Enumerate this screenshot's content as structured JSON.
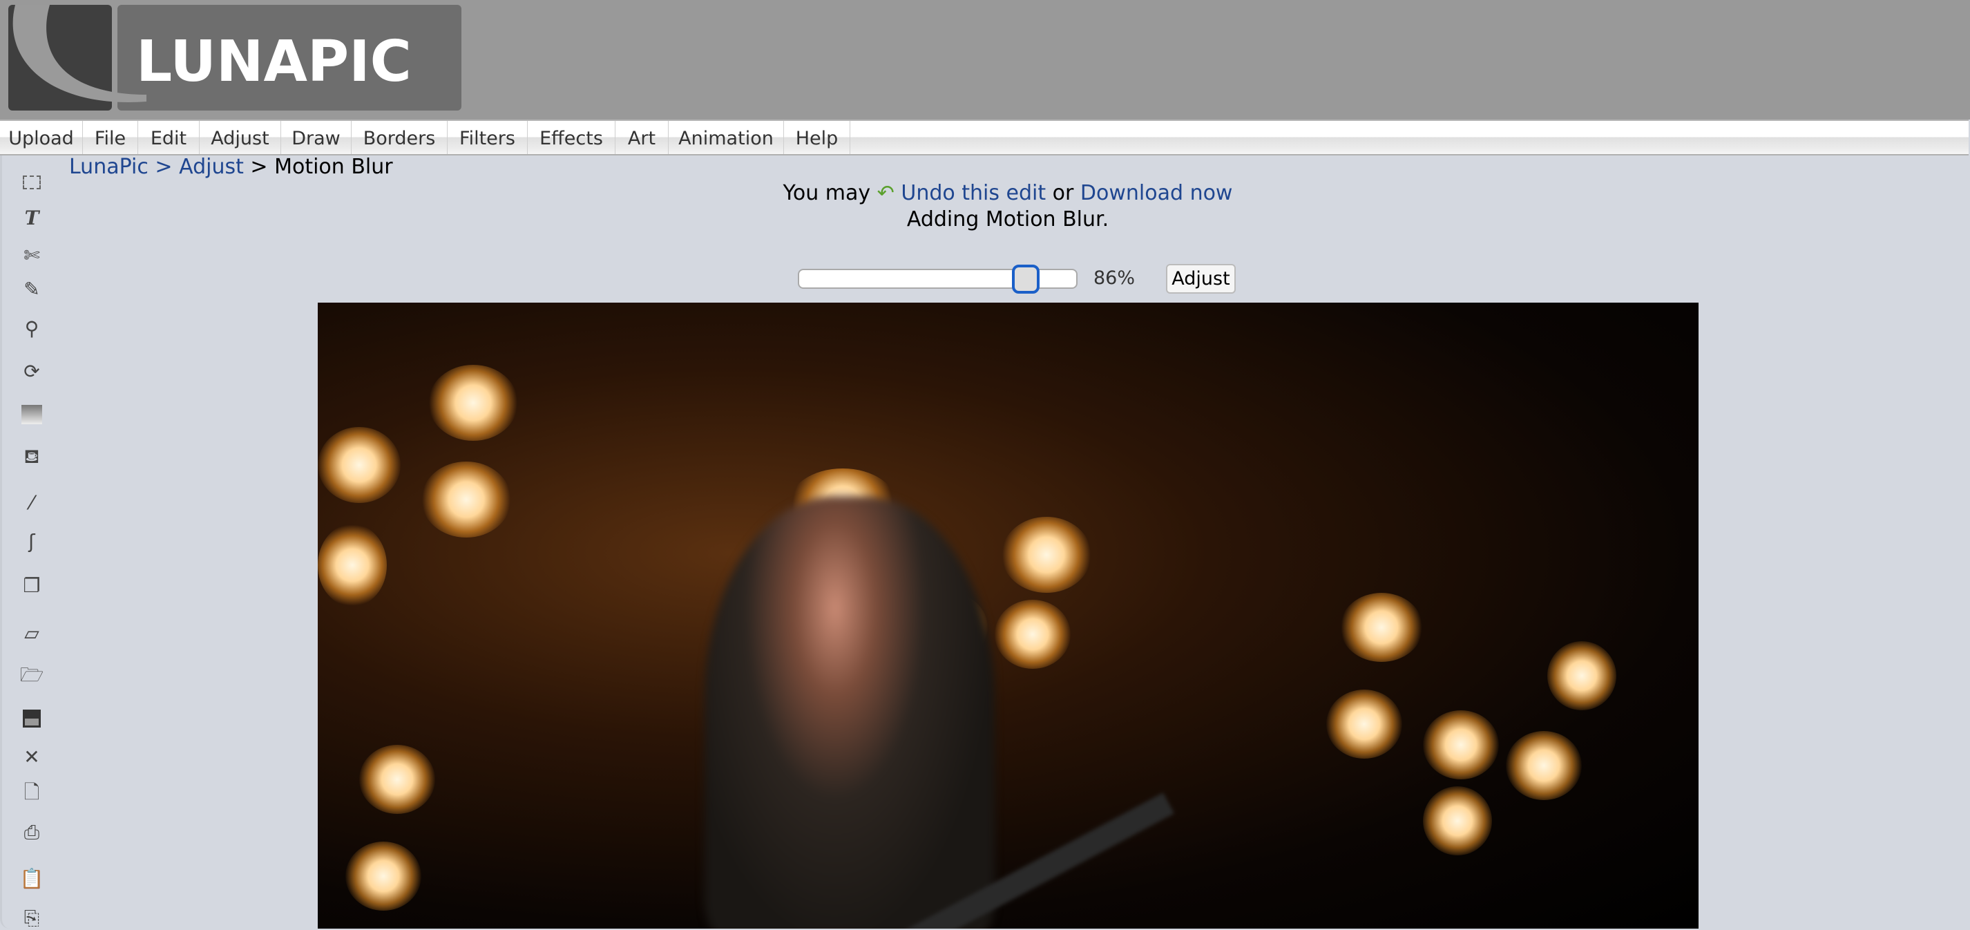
{
  "header": {
    "logo_text": "LUNAPIC"
  },
  "menu": [
    "Upload",
    "File",
    "Edit",
    "Adjust",
    "Draw",
    "Borders",
    "Filters",
    "Effects",
    "Art",
    "Animation",
    "Help"
  ],
  "toolbar": [
    "select-icon",
    "text-icon",
    "scissors-icon",
    "pencil-icon",
    "magnifier-icon",
    "rotate-icon",
    "gradient-icon",
    "paint-bucket-icon",
    "eyedropper-icon",
    "brush-icon",
    "layers-icon",
    "eraser-icon",
    "open-folder-icon",
    "save-icon",
    "close-icon",
    "new-document-icon",
    "print-icon",
    "paste-icon",
    "copy-icon"
  ],
  "breadcrumb": {
    "root": "LunaPic",
    "sep1": " > ",
    "section": "Adjust",
    "sep2": " > ",
    "current": "Motion Blur"
  },
  "notice": {
    "prefix": "You may ",
    "undo": "Undo this edit",
    "middle": " or ",
    "download": "Download now",
    "status": "Adding Motion Blur."
  },
  "slider": {
    "value": 86,
    "label": "86%"
  },
  "adjust_button": "Adjust",
  "colors": {
    "link": "#1f4690",
    "header": "#999999",
    "background": "#d4d8e0",
    "slider_accent": "#1a5fc8"
  }
}
